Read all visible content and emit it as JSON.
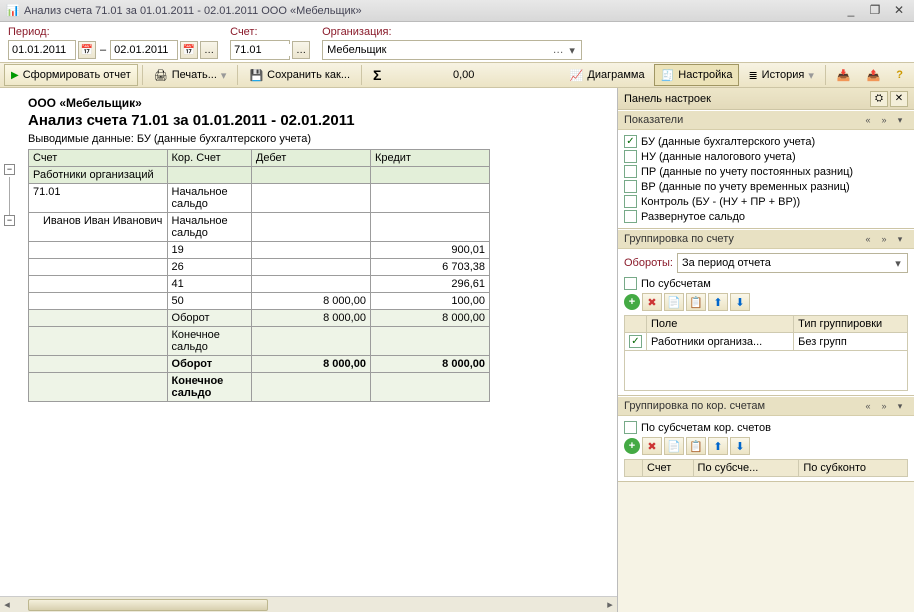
{
  "window": {
    "title": "Анализ счета 71.01 за 01.01.2011 - 02.01.2011 ООО «Мебельщик»",
    "min": "_",
    "restore": "❐",
    "close": "✕"
  },
  "params": {
    "period_label": "Период:",
    "date_from": "01.01.2011",
    "date_to": "02.01.2011",
    "account_label": "Счет:",
    "account": "71.01",
    "org_label": "Организация:",
    "org": "Мебельщик"
  },
  "toolbar": {
    "generate": "Сформировать отчет",
    "print": "Печать...",
    "save_as": "Сохранить как...",
    "sum_value": "0,00",
    "diagram": "Диаграмма",
    "settings": "Настройка",
    "history": "История"
  },
  "report": {
    "company": "ООО «Мебельщик»",
    "title": "Анализ счета 71.01 за 01.01.2011 - 02.01.2011",
    "subtitle": "Выводимые данные: БУ (данные бухгалтерского учета)",
    "cols": {
      "acct": "Счет",
      "kor": "Кор. Счет",
      "debit": "Дебет",
      "credit": "Кредит"
    },
    "sub_header": "Работники организаций",
    "rows": [
      {
        "acct": "71.01",
        "kor": "Начальное сальдо",
        "debit": "",
        "credit": ""
      },
      {
        "acct": "Иванов Иван Иванович",
        "kor": "Начальное сальдо",
        "debit": "",
        "credit": "",
        "indent": true
      },
      {
        "acct": "",
        "kor": "19",
        "debit": "",
        "credit": "900,01"
      },
      {
        "acct": "",
        "kor": "26",
        "debit": "",
        "credit": "6 703,38"
      },
      {
        "acct": "",
        "kor": "41",
        "debit": "",
        "credit": "296,61"
      },
      {
        "acct": "",
        "kor": "50",
        "debit": "8 000,00",
        "credit": "100,00"
      },
      {
        "acct": "",
        "kor": "Оборот",
        "debit": "8 000,00",
        "credit": "8 000,00",
        "shade": true
      },
      {
        "acct": "",
        "kor": "Конечное сальдо",
        "debit": "",
        "credit": "",
        "shade": true
      },
      {
        "acct": "",
        "kor": "Оборот",
        "debit": "8 000,00",
        "credit": "8 000,00",
        "bold": true,
        "shade": true
      },
      {
        "acct": "",
        "kor": "Конечное сальдо",
        "debit": "",
        "credit": "",
        "bold": true,
        "shade": true
      }
    ]
  },
  "settings_panel": {
    "header": "Панель настроек",
    "indicators": {
      "title": "Показатели",
      "items": [
        {
          "on": true,
          "label": "БУ (данные бухгалтерского учета)"
        },
        {
          "on": false,
          "label": "НУ (данные налогового учета)"
        },
        {
          "on": false,
          "label": "ПР (данные по учету постоянных разниц)"
        },
        {
          "on": false,
          "label": "ВР (данные по учету временных разниц)"
        },
        {
          "on": false,
          "label": "Контроль (БУ - (НУ + ПР + ВР))"
        },
        {
          "on": false,
          "label": "Развернутое сальдо"
        }
      ]
    },
    "group_acct": {
      "title": "Группировка по счету",
      "turnover_label": "Обороты:",
      "turnover_value": "За период отчета",
      "by_sub": "По субсчетам",
      "cols": {
        "field": "Поле",
        "type": "Тип группировки"
      },
      "row": {
        "on": true,
        "field": "Работники организа...",
        "type": "Без групп"
      }
    },
    "group_kor": {
      "title": "Группировка по кор. счетам",
      "by_sub": "По субсчетам кор. счетов",
      "cols": {
        "acct": "Счет",
        "sub": "По субсче...",
        "subk": "По субконто"
      }
    }
  }
}
